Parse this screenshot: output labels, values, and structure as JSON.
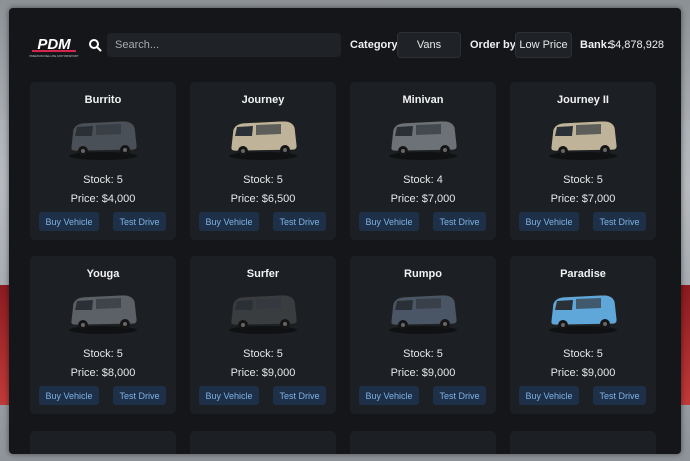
{
  "header": {
    "logo_text": "PDM",
    "logo_subtext": "PREMIUM DELUXE MOTORSPORT",
    "search_placeholder": "Search...",
    "category_label": "Category:",
    "category_value": "Vans",
    "order_label": "Order by:",
    "order_value": "Low Price",
    "bank_label": "Bank:",
    "bank_value": "$4,878,928"
  },
  "vehicles": [
    {
      "name": "Burrito",
      "stock": "Stock: 5",
      "price": "Price: $4,000",
      "buy_label": "Buy Vehicle",
      "test_label": "Test Drive",
      "color": "#4a5057"
    },
    {
      "name": "Journey",
      "stock": "Stock: 5",
      "price": "Price: $6,500",
      "buy_label": "Buy Vehicle",
      "test_label": "Test Drive",
      "color": "#bfb49a"
    },
    {
      "name": "Minivan",
      "stock": "Stock: 4",
      "price": "Price: $7,000",
      "buy_label": "Buy Vehicle",
      "test_label": "Test Drive",
      "color": "#6d7278"
    },
    {
      "name": "Journey II",
      "stock": "Stock: 5",
      "price": "Price: $7,000",
      "buy_label": "Buy Vehicle",
      "test_label": "Test Drive",
      "color": "#bfb49a"
    },
    {
      "name": "Youga",
      "stock": "Stock: 5",
      "price": "Price: $8,000",
      "buy_label": "Buy Vehicle",
      "test_label": "Test Drive",
      "color": "#5b6166"
    },
    {
      "name": "Surfer",
      "stock": "Stock: 5",
      "price": "Price: $9,000",
      "buy_label": "Buy Vehicle",
      "test_label": "Test Drive",
      "color": "#3a3d40"
    },
    {
      "name": "Rumpo",
      "stock": "Stock: 5",
      "price": "Price: $9,000",
      "buy_label": "Buy Vehicle",
      "test_label": "Test Drive",
      "color": "#4a5565"
    },
    {
      "name": "Paradise",
      "stock": "Stock: 5",
      "price": "Price: $9,000",
      "buy_label": "Buy Vehicle",
      "test_label": "Test Drive",
      "color": "#5fa7d8"
    }
  ],
  "colors": {
    "accent": "#7fb2e6",
    "button_bg": "#1e3048",
    "panel_bg": "#141619",
    "card_bg": "#1c1f23"
  }
}
